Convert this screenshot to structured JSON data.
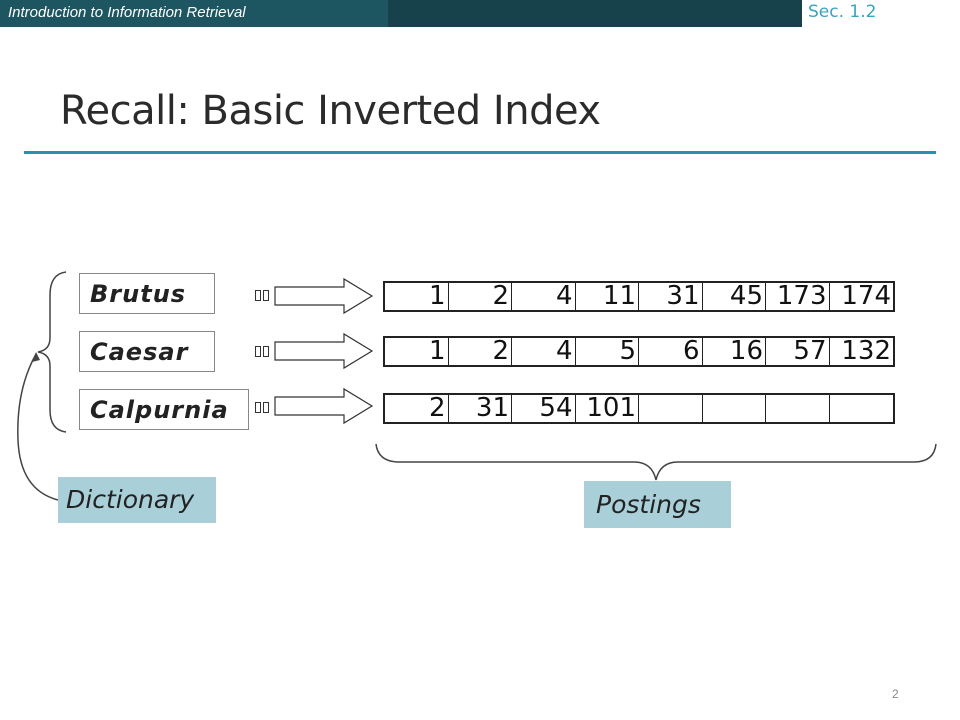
{
  "header": {
    "course_title": "Introduction to Information Retrieval",
    "section": "Sec. 1.2"
  },
  "slide": {
    "title": "Recall: Basic Inverted Index",
    "page_number": "2"
  },
  "dictionary": {
    "label": "Dictionary",
    "terms": [
      "Brutus",
      "Caesar",
      "Calpurnia"
    ]
  },
  "postings": {
    "label": "Postings",
    "lists": [
      [
        "1",
        "2",
        "4",
        "11",
        "31",
        "45",
        "173",
        "174"
      ],
      [
        "1",
        "2",
        "4",
        "5",
        "6",
        "16",
        "57",
        "132"
      ],
      [
        "2",
        "31",
        "54",
        "101",
        "",
        "",
        "",
        ""
      ]
    ]
  },
  "colors": {
    "header_bar": "#17424c",
    "accent": "#2b8fb0",
    "label_fill": "#a9cfd8"
  }
}
